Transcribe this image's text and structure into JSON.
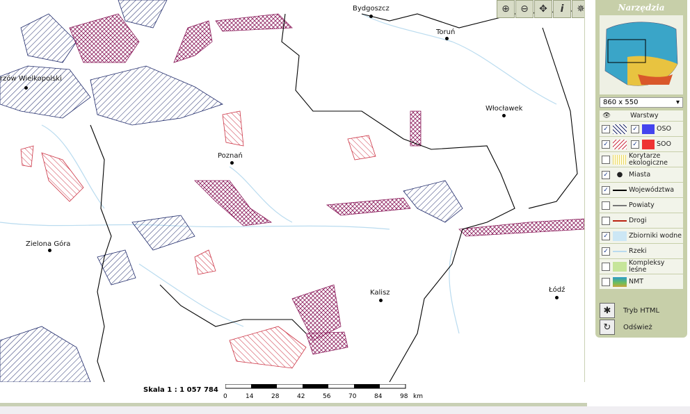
{
  "map": {
    "cities": [
      {
        "name": "Bydgoszcz",
        "dot": true
      },
      {
        "name": "Toruń",
        "dot": true
      },
      {
        "name": "Włocławek",
        "dot": true
      },
      {
        "name": "rzów Wielkopolski",
        "dot": true
      },
      {
        "name": "Poznań",
        "dot": true
      },
      {
        "name": "Zielona Góra",
        "dot": true
      },
      {
        "name": "Kalisz",
        "dot": true
      },
      {
        "name": "Łódź",
        "dot": true
      }
    ]
  },
  "toolbar": {
    "zoom_in_icon": "zoom-in-icon",
    "zoom_out_icon": "zoom-out-icon",
    "pan_icon": "pan-icon",
    "info_icon": "info-icon",
    "full_extent_icon": "compass-icon"
  },
  "panel": {
    "title": "Narzędzia",
    "size_value": "860 x 550",
    "layers_header": "Warstwy",
    "layers": [
      {
        "name": "OSO",
        "checked": true,
        "color": "#4444ee"
      },
      {
        "name": "SOO",
        "checked": true,
        "color": "#ee3333"
      },
      {
        "name": "Korytarze ekologiczne",
        "checked": false
      },
      {
        "name": "Miasta",
        "checked": true
      },
      {
        "name": "Województwa",
        "checked": true
      },
      {
        "name": "Powiaty",
        "checked": false
      },
      {
        "name": "Drogi",
        "checked": false
      },
      {
        "name": "Zbiorniki wodne",
        "checked": true
      },
      {
        "name": "Rzeki",
        "checked": true
      },
      {
        "name": "Kompleksy leśne",
        "checked": false
      },
      {
        "name": "NMT",
        "checked": false
      }
    ],
    "html_mode_label": "Tryb HTML",
    "refresh_label": "Odśwież"
  },
  "scale": {
    "label": "Skala 1 : 1 057 784",
    "ticks": [
      "0",
      "14",
      "28",
      "42",
      "56",
      "70",
      "84",
      "98"
    ],
    "unit": "km"
  },
  "colors": {
    "oso": "#4444ee",
    "soo": "#ee3333",
    "panel": "#c7cfa9",
    "water": "#cce7f5"
  }
}
